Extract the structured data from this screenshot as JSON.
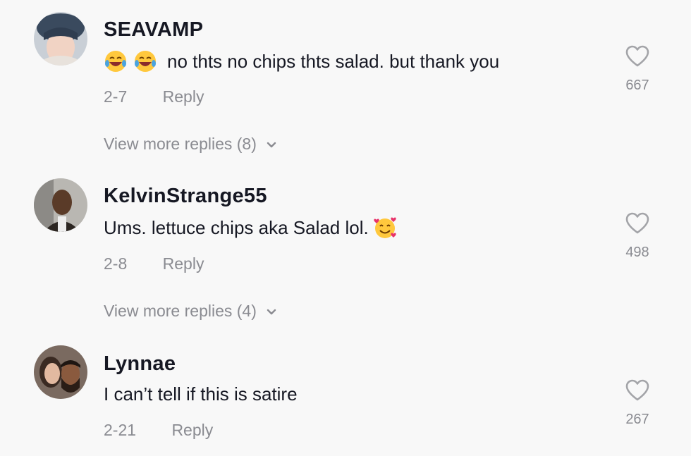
{
  "comments": [
    {
      "username": "SEAVAMP",
      "text": "no thts no chips thts salad. but thank you",
      "date": "2-7",
      "reply_label": "Reply",
      "likes": "667",
      "view_more": "View more replies (8)",
      "emojis_before": [
        "laughing-tears-emoji",
        "laughing-tears-emoji"
      ]
    },
    {
      "username": "KelvinStrange55",
      "text": "Ums. lettuce chips aka Salad lol.",
      "date": "2-8",
      "reply_label": "Reply",
      "likes": "498",
      "view_more": "View more replies (4)",
      "emojis_after": [
        "smiling-face-with-hearts-emoji"
      ]
    },
    {
      "username": "Lynnae",
      "text": "I can’t tell if this is satire",
      "date": "2-21",
      "reply_label": "Reply",
      "likes": "267"
    }
  ],
  "icons": {
    "heart": "heart-outline-icon",
    "chevron": "chevron-down-icon"
  },
  "colors": {
    "background": "#f8f8f8",
    "primary_text": "#161823",
    "secondary_text": "#8a8b91"
  }
}
